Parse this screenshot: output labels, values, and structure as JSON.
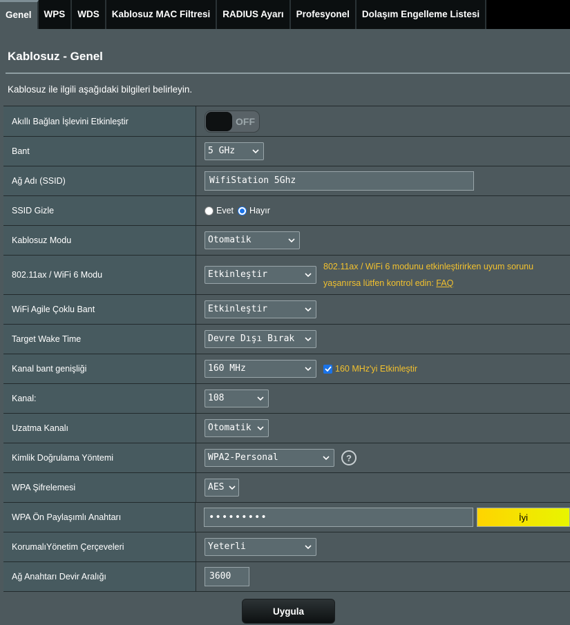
{
  "tabs": [
    {
      "label": "Genel",
      "active": true
    },
    {
      "label": "WPS"
    },
    {
      "label": "WDS"
    },
    {
      "label": "Kablosuz MAC Filtresi"
    },
    {
      "label": "RADIUS Ayarı"
    },
    {
      "label": "Profesyonel"
    },
    {
      "label": "Dolaşım Engelleme Listesi"
    }
  ],
  "header": {
    "title": "Kablosuz - Genel",
    "description": "Kablosuz ile ilgili aşağıdaki bilgileri belirleyin."
  },
  "form": {
    "smart_connect": {
      "label": "Akıllı Bağlan İşlevini Etkinleştir",
      "state": "OFF"
    },
    "band": {
      "label": "Bant",
      "value": "5 GHz"
    },
    "ssid": {
      "label": "Ağ Adı (SSID)",
      "value": "WifiStation 5Ghz"
    },
    "hide_ssid": {
      "label": "SSID Gizle",
      "option_yes": "Evet",
      "option_no": "Hayır",
      "selected": "Hayır"
    },
    "wireless_mode": {
      "label": "Kablosuz Modu",
      "value": "Otomatik"
    },
    "wifi6_mode": {
      "label": "802.11ax / WiFi 6 Modu",
      "value": "Etkinleştir",
      "hint_line1": "802.11ax / WiFi 6 modunu etkinleştirirken uyum sorunu",
      "hint_line2": "yaşanırsa lütfen kontrol edin: ",
      "hint_link": "FAQ"
    },
    "agile_multiband": {
      "label": "WiFi Agile Çoklu Bant",
      "value": "Etkinleştir"
    },
    "target_wake_time": {
      "label": "Target Wake Time",
      "value": "Devre Dışı Bırak"
    },
    "channel_bandwidth": {
      "label": "Kanal bant genişliği",
      "value": "160 MHz",
      "checkbox_label": "160 MHz'yi Etkinleştir",
      "checkbox_checked": true
    },
    "channel": {
      "label": "Kanal:",
      "value": "108"
    },
    "extension_channel": {
      "label": "Uzatma Kanalı",
      "value": "Otomatik"
    },
    "auth_method": {
      "label": "Kimlik Doğrulama Yöntemi",
      "value": "WPA2-Personal"
    },
    "wpa_encryption": {
      "label": "WPA Şifrelemesi",
      "value": "AES"
    },
    "wpa_psk": {
      "label": "WPA Ön Paylaşımlı Anahtarı",
      "value": "•••••••••",
      "strength": "İyi"
    },
    "pmf": {
      "label": "KorumalıYönetim Çerçeveleri",
      "value": "Yeterli"
    },
    "key_rotation": {
      "label": "Ağ Anahtarı Devir Aralığı",
      "value": "3600"
    }
  },
  "apply_label": "Uygula",
  "icons": {
    "dropdown": "chevron-down-icon",
    "help": "help-icon",
    "check": "check-icon"
  }
}
